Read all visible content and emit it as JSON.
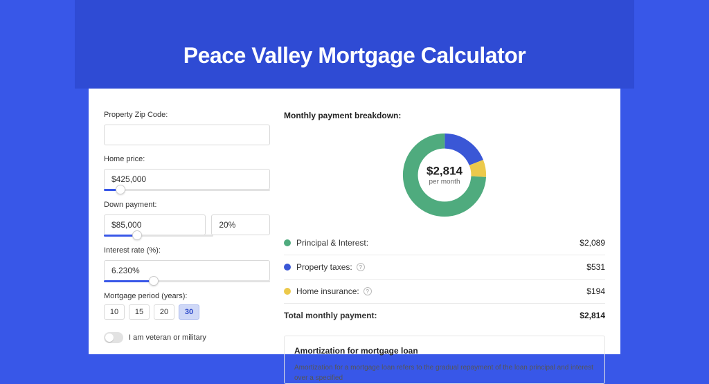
{
  "page": {
    "title": "Peace Valley Mortgage Calculator"
  },
  "form": {
    "zip_label": "Property Zip Code:",
    "zip_value": "",
    "home_price_label": "Home price:",
    "home_price_value": "$425,000",
    "down_payment_label": "Down payment:",
    "down_payment_value": "$85,000",
    "down_payment_pct": "20%",
    "interest_label": "Interest rate (%):",
    "interest_value": "6.230%",
    "period_label": "Mortgage period (years):",
    "period_options": [
      "10",
      "15",
      "20",
      "30"
    ],
    "period_selected": "30",
    "veteran_label": "I am veteran or military"
  },
  "breakdown": {
    "title": "Monthly payment breakdown:",
    "center_value": "$2,814",
    "center_sub": "per month",
    "colors": {
      "principal_interest": "#4fab7e",
      "property_taxes": "#3a57d6",
      "home_insurance": "#ecc94b"
    },
    "items": [
      {
        "key": "principal_interest",
        "label": "Principal & Interest:",
        "value": "$2,089",
        "info": false
      },
      {
        "key": "property_taxes",
        "label": "Property taxes:",
        "value": "$531",
        "info": true
      },
      {
        "key": "home_insurance",
        "label": "Home insurance:",
        "value": "$194",
        "info": true
      }
    ],
    "total_label": "Total monthly payment:",
    "total_value": "$2,814"
  },
  "chart_data": {
    "type": "pie",
    "title": "Monthly payment breakdown",
    "series": [
      {
        "name": "Principal & Interest",
        "value": 2089,
        "color": "#4fab7e"
      },
      {
        "name": "Property taxes",
        "value": 531,
        "color": "#3a57d6"
      },
      {
        "name": "Home insurance",
        "value": 194,
        "color": "#ecc94b"
      }
    ],
    "total": 2814,
    "center_label": "$2,814 per month"
  },
  "amortization": {
    "title": "Amortization for mortgage loan",
    "text": "Amortization for a mortgage loan refers to the gradual repayment of the loan principal and interest over a specified"
  }
}
